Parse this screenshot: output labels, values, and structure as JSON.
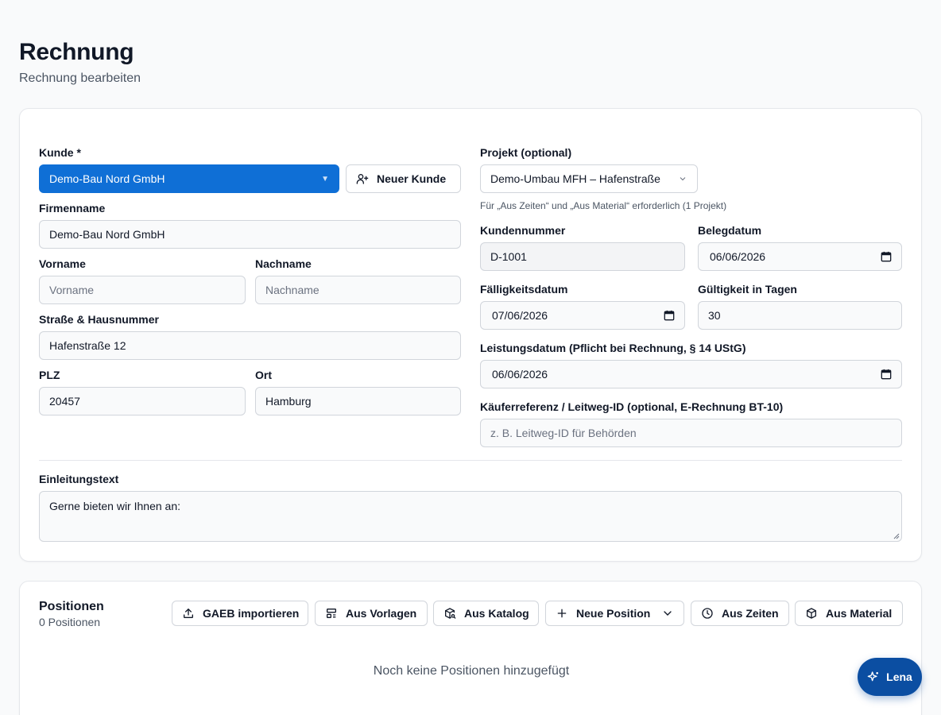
{
  "header": {
    "title": "Rechnung",
    "subtitle": "Rechnung bearbeiten"
  },
  "customer": {
    "kunde_label": "Kunde *",
    "kunde_value": "Demo-Bau Nord GmbH",
    "new_customer_label": "Neuer Kunde",
    "firmenname_label": "Firmenname",
    "firmenname_value": "Demo-Bau Nord GmbH",
    "vorname_label": "Vorname",
    "vorname_placeholder": "Vorname",
    "nachname_label": "Nachname",
    "nachname_placeholder": "Nachname",
    "strasse_label": "Straße & Hausnummer",
    "strasse_value": "Hafenstraße 12",
    "plz_label": "PLZ",
    "plz_value": "20457",
    "ort_label": "Ort",
    "ort_value": "Hamburg"
  },
  "document": {
    "projekt_label": "Projekt (optional)",
    "projekt_value": "Demo-Umbau MFH – Hafenstraße",
    "projekt_hint": "Für „Aus Zeiten“ und „Aus Material“ erforderlich (1 Projekt)",
    "kundennummer_label": "Kundennummer",
    "kundennummer_value": "D-1001",
    "belegdatum_label": "Belegdatum",
    "belegdatum_value": "06/06/2026",
    "faelligkeit_label": "Fälligkeitsdatum",
    "faelligkeit_value": "07/06/2026",
    "gueltigkeit_label": "Gültigkeit in Tagen",
    "gueltigkeit_value": "30",
    "leistungsdatum_label": "Leistungsdatum (Pflicht bei Rechnung, § 14 UStG)",
    "leistungsdatum_value": "06/06/2026",
    "referenz_label": "Käuferreferenz / Leitweg-ID (optional, E-Rechnung BT-10)",
    "referenz_placeholder": "z. B. Leitweg-ID für Behörden"
  },
  "intro": {
    "label": "Einleitungstext",
    "value": "Gerne bieten wir Ihnen an:"
  },
  "positions": {
    "title": "Positionen",
    "count": "0 Positionen",
    "buttons": {
      "gaeb": "GAEB importieren",
      "vorlagen": "Aus Vorlagen",
      "katalog": "Aus Katalog",
      "neue": "Neue Position",
      "zeiten": "Aus Zeiten",
      "material": "Aus Material"
    },
    "empty": "Noch keine Positionen hinzugefügt"
  },
  "assistant": {
    "label": "Lena"
  },
  "colors": {
    "accent": "#0f6fd6",
    "assistant": "#0b4ea2"
  }
}
